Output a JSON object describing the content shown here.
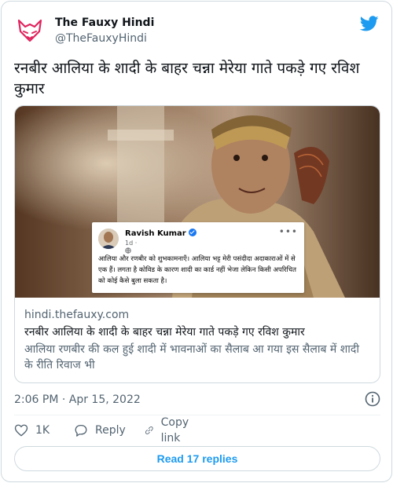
{
  "author": {
    "display_name": "The Fauxy Hindi",
    "handle": "@TheFauxyHindi",
    "avatar_icon": "fox-logo-icon"
  },
  "brand": {
    "twitter_icon": "twitter-bird-icon",
    "accent_color": "#1d9bf0"
  },
  "tweet": {
    "text": "रनबीर आलिया के शादी के बाहर चन्ना मेरेया गाते पकड़े गए रविश कुमार",
    "timestamp": "2:06 PM · Apr 15, 2022"
  },
  "link_card": {
    "fb_post": {
      "name": "Ravish Kumar",
      "time": "1d · ",
      "menu_icon": "more-dots-icon",
      "text": "आलिया और रणबीर को शुभकामनाएँ। आलिया भट्ट मेरी पसंदीदा अदाकाराओं में से एक हैं। लगता है कोविड के कारण शादी का कार्ड नहीं भेजा लेकिन किसी अपरिचित को कोई कैसे बुला सकता है।"
    },
    "domain": "hindi.thefauxy.com",
    "title": "रनबीर आलिया के शादी के बाहर चन्ना मेरेया गाते पकड़े गए रविश कुमार",
    "description": "आलिया रणबीर की कल हुई शादी में भावनाओं का सैलाब आ गया इस सैलाब में शादी के रीति रिवाज भी"
  },
  "actions": {
    "like_count": "1K",
    "reply_label": "Reply",
    "copy_link_label": "Copy link",
    "read_replies_label": "Read 17 replies"
  }
}
